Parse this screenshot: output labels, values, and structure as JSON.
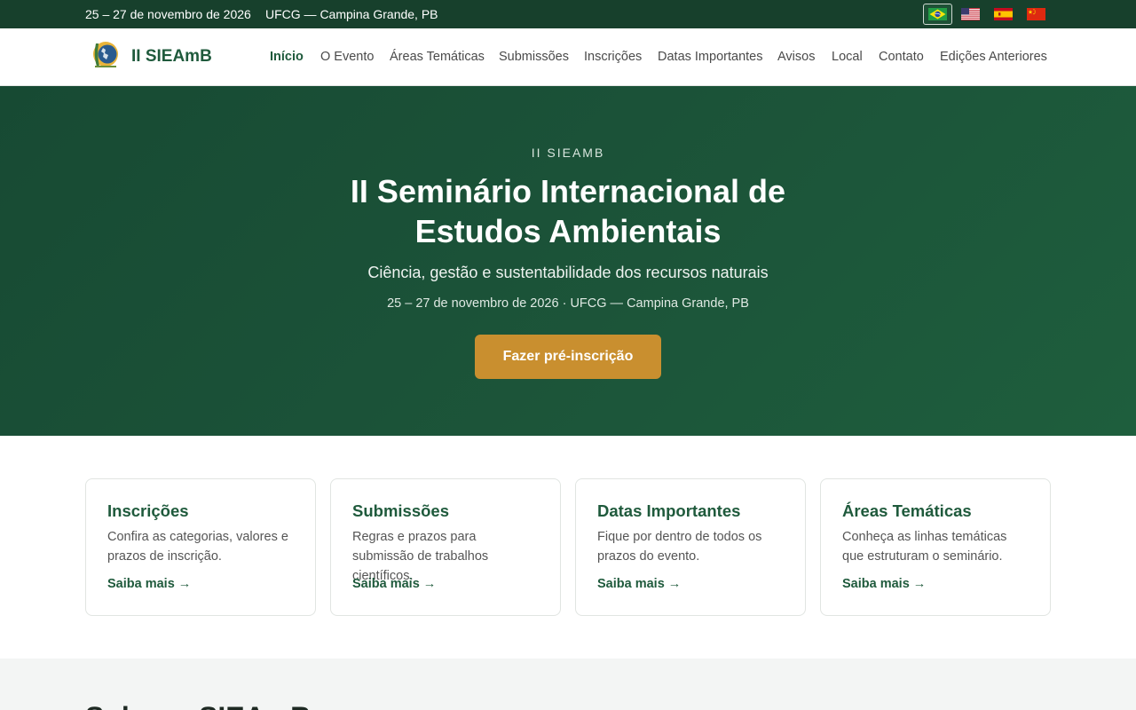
{
  "topbar": {
    "date": "25 – 27 de novembro de 2026",
    "location": "UFCG — Campina Grande, PB",
    "languages": [
      {
        "code": "pt-BR",
        "icon": "brazil-flag-icon",
        "active": true
      },
      {
        "code": "en-US",
        "icon": "us-flag-icon",
        "active": false
      },
      {
        "code": "es",
        "icon": "spain-flag-icon",
        "active": false
      },
      {
        "code": "zh",
        "icon": "china-flag-icon",
        "active": false
      }
    ]
  },
  "header": {
    "brand": "II SIEAmB",
    "logo_icon": "sieamb-logo-icon",
    "nav": [
      {
        "label": "Início",
        "active": true
      },
      {
        "label": "O Evento"
      },
      {
        "label": "Áreas Temáticas"
      },
      {
        "label": "Submissões"
      },
      {
        "label": "Inscrições"
      },
      {
        "label": "Datas Importantes"
      },
      {
        "label": "Avisos"
      },
      {
        "label": "Local"
      },
      {
        "label": "Contato"
      },
      {
        "label": "Edições Anteriores"
      }
    ]
  },
  "hero": {
    "eyebrow": "II SIEAMB",
    "title": "II Seminário Internacional de Estudos Ambientais",
    "subtitle": "Ciência, gestão e sustentabilidade dos recursos naturais",
    "date_line": "25 – 27 de novembro de 2026 · UFCG — Campina Grande, PB",
    "cta": "Fazer pré-inscrição"
  },
  "cards": [
    {
      "title": "Inscrições",
      "text": "Confira as categorias, valores e prazos de inscrição.",
      "link": "Saiba mais →"
    },
    {
      "title": "Submissões",
      "text": "Regras e prazos para submissão de trabalhos científicos.",
      "link": "Saiba mais →"
    },
    {
      "title": "Datas Importantes",
      "text": "Fique por dentro de todos os prazos do evento.",
      "link": "Saiba mais →"
    },
    {
      "title": "Áreas Temáticas",
      "text": "Conheça as linhas temáticas que estruturam o seminário.",
      "link": "Saiba mais →"
    }
  ],
  "about": {
    "heading": "Sobre o SIEAmB"
  },
  "colors": {
    "topbar": "#17402c",
    "primary": "#1f5a3c",
    "accent": "#c98f2f"
  }
}
